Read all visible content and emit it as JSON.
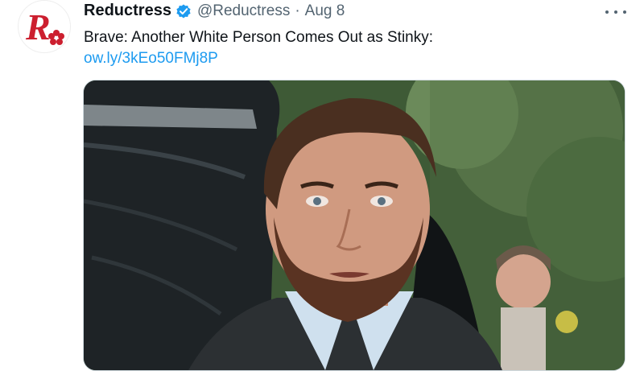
{
  "tweet": {
    "author_name": "Reductress",
    "handle": "@Reductress",
    "separator": "·",
    "date": "Aug 8",
    "text": "Brave: Another White Person Comes Out as Stinky:",
    "link": "ow.ly/3kEo50FMj8P",
    "avatar_logo_letter": "R",
    "icons": {
      "verified": "verified-badge-icon",
      "more": "more-options-icon"
    }
  },
  "colors": {
    "name": "#0f1419",
    "secondary_text": "#536471",
    "link": "#1d9bf0",
    "verified": "#1d9bf0",
    "logo_red": "#cc1f2f"
  }
}
